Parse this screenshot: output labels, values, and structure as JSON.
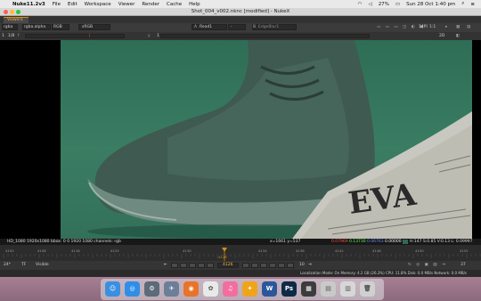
{
  "menubar": {
    "app": "Nuke11.2v3",
    "items": [
      "File",
      "Edit",
      "Workspace",
      "Viewer",
      "Render",
      "Cache",
      "Help"
    ],
    "battery": "27%",
    "clock": "Sun 28 Oct  1:40 pm"
  },
  "window": {
    "title": "Shot_004_v002.nknc [modified] - NukeX"
  },
  "tabs": [
    {
      "label": "Viewer1"
    }
  ],
  "toolbar": {
    "channels": "rgba",
    "layer": "rgba.alpha",
    "display": "RGB",
    "lut": "sRGB",
    "input_a": "Read1",
    "input_b": "EdgeBlur1",
    "resolution": "1:1",
    "proxy": "14PI",
    "frame_field": "1",
    "frame_range": "1/8",
    "exposure_label": "f",
    "gamma_label": "y",
    "gamma_value": "1",
    "zoom": "2D"
  },
  "info_bar": {
    "format": "HD_1080 1920x1080  bbox: 0 0 1920 1080 channels: rgb",
    "coords": "x=1661 y=537",
    "r": "0.07969",
    "g": "0.13730",
    "b": "0.06763",
    "a": "0.00000",
    "hsvl": "H:147 S:0.85 V:0.13  L: 0.09997"
  },
  "timeline": {
    "labels": [
      "4100",
      "4108",
      "4116",
      "4125",
      "4130",
      "4134",
      "4138",
      "4142",
      "4146",
      "4150",
      "4152"
    ],
    "current_frame": "4126"
  },
  "playback": {
    "fps": "24*",
    "tf": "TF",
    "visible": "Visible",
    "frame": "4126",
    "step": "10",
    "end": "37"
  },
  "status": "Localization Mode: On  Memory: 4.2 GB (26.3%)  CPU: 11.8%  Disk: 0.0 MB/s  Network: 0.0 MB/s",
  "dock": [
    {
      "name": "finder-icon",
      "color": "#3b8fe0",
      "glyph": "☺"
    },
    {
      "name": "safari-icon",
      "color": "#2f8ee8",
      "glyph": "◎"
    },
    {
      "name": "launchpad-icon",
      "color": "#5d6a78",
      "glyph": "⚙"
    },
    {
      "name": "rocket-icon",
      "color": "#6b7f99",
      "glyph": "✈"
    },
    {
      "name": "firefox-icon",
      "color": "#e8742a",
      "glyph": "◉"
    },
    {
      "name": "photos-icon",
      "color": "#e9e9e9",
      "glyph": "✿"
    },
    {
      "name": "itunes-icon",
      "color": "#f36ea0",
      "glyph": "♫"
    },
    {
      "name": "nuke-icon",
      "color": "#f0a419",
      "glyph": "✦"
    },
    {
      "name": "word-icon",
      "color": "#2b579a",
      "glyph": "W"
    },
    {
      "name": "photoshop-icon",
      "color": "#0e2a47",
      "glyph": "Ps"
    },
    {
      "name": "blackmagic-icon",
      "color": "#3c3c3c",
      "glyph": "▦"
    },
    {
      "name": "image-capture-icon",
      "color": "#c9c9c9",
      "glyph": "▤"
    },
    {
      "name": "downloads-icon",
      "color": "#d7d7d7",
      "glyph": "▥"
    },
    {
      "name": "trash-icon",
      "color": "#d0d0d0",
      "glyph": "🗑"
    }
  ],
  "colors": {
    "accent": "#d58a1a",
    "green_screen": "#3a7d63"
  }
}
